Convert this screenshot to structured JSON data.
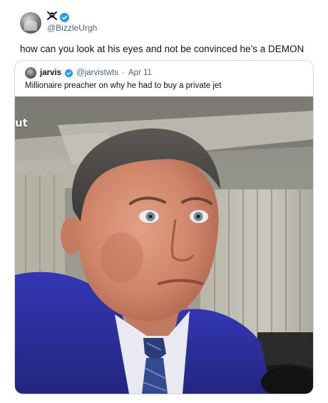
{
  "post": {
    "author_handle": "@BizzleUrgh",
    "author_name_icon": "skull-crossbones-icon",
    "verified": true,
    "text": "how can you look at his eyes and not be convinced he’s a DEMON"
  },
  "quote": {
    "author_name": "jarvis",
    "author_handle": "@jarvistwts",
    "separator": "·",
    "date": "Apr 11",
    "verified": true,
    "text": "Millionaire preacher on why he had to buy a private jet",
    "media": {
      "watermark_text": "ut"
    }
  },
  "colors": {
    "verified_blue": "#1d9bf0",
    "secondary_text": "#536471",
    "border": "#cfd9de",
    "suit_blue": "#2b2fa0"
  }
}
